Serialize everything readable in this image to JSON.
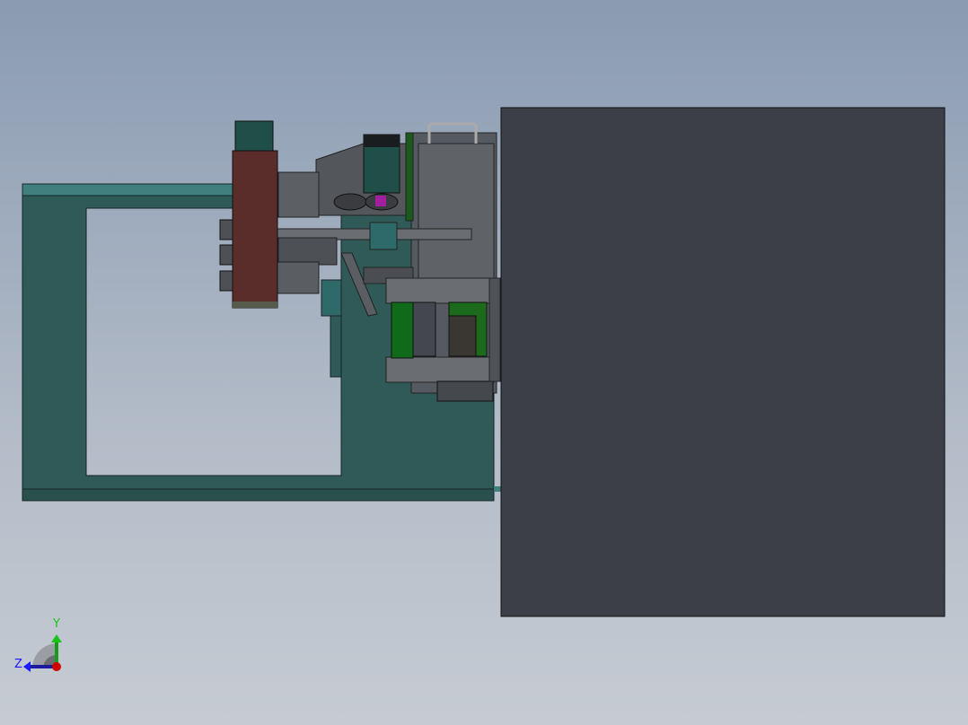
{
  "viewport": {
    "background_top": "#8a9bb2",
    "background_bottom": "#c6cbd3"
  },
  "model": {
    "frame_color": "#2f5a58",
    "rail_color": "#3f7f7e",
    "cover_color": "#3c3f48",
    "plate_color": "#5a2d2a",
    "motor_color": "#1f4f48",
    "roller_color": "#0f6a1a",
    "accent_magenta": "#a020a0"
  },
  "triad": {
    "y_label": "Y",
    "z_label": "Z",
    "y_color": "#19c419",
    "z_color": "#1a1aff",
    "x_color": "#d00000"
  }
}
